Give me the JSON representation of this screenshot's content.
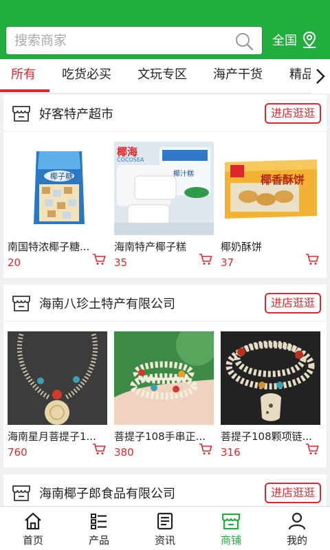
{
  "search": {
    "placeholder": "搜索商家",
    "region_label": "全国"
  },
  "tabs": [
    {
      "label": "所有"
    },
    {
      "label": "吃货必买"
    },
    {
      "label": "文玩专区"
    },
    {
      "label": "海产干货"
    },
    {
      "label": "精品"
    }
  ],
  "shops": [
    {
      "name": "好客特产超市",
      "visit_label": "进店逛逛",
      "products": [
        {
          "name": "南国特浓椰子糖...",
          "price": "20",
          "package_text": "椰子糖"
        },
        {
          "name": "海南特产椰子糕",
          "price": "35",
          "brand_text": "椰海",
          "brand_sub": "COCOSEA",
          "package_text": "椰汁糕"
        },
        {
          "name": "椰奶酥饼",
          "price": "37",
          "package_text": "椰香酥饼"
        }
      ]
    },
    {
      "name": "海南八珍土特产有限公司",
      "visit_label": "进店逛逛",
      "products": [
        {
          "name": "海南星月菩提子1...",
          "price": "760"
        },
        {
          "name": "菩提子108手串正...",
          "price": "380"
        },
        {
          "name": "菩提子108颗项链...",
          "price": "316"
        }
      ]
    },
    {
      "name": "海南椰子郎食品有限公司",
      "visit_label": "进店逛逛",
      "products": []
    }
  ],
  "bottom_nav": [
    {
      "label": "首页",
      "icon": "home-icon"
    },
    {
      "label": "产品",
      "icon": "list-icon"
    },
    {
      "label": "资讯",
      "icon": "news-icon"
    },
    {
      "label": "商铺",
      "icon": "store-icon"
    },
    {
      "label": "我的",
      "icon": "user-icon"
    }
  ],
  "colors": {
    "brand_green": "#22ae3f",
    "accent_red": "#e0252c"
  }
}
